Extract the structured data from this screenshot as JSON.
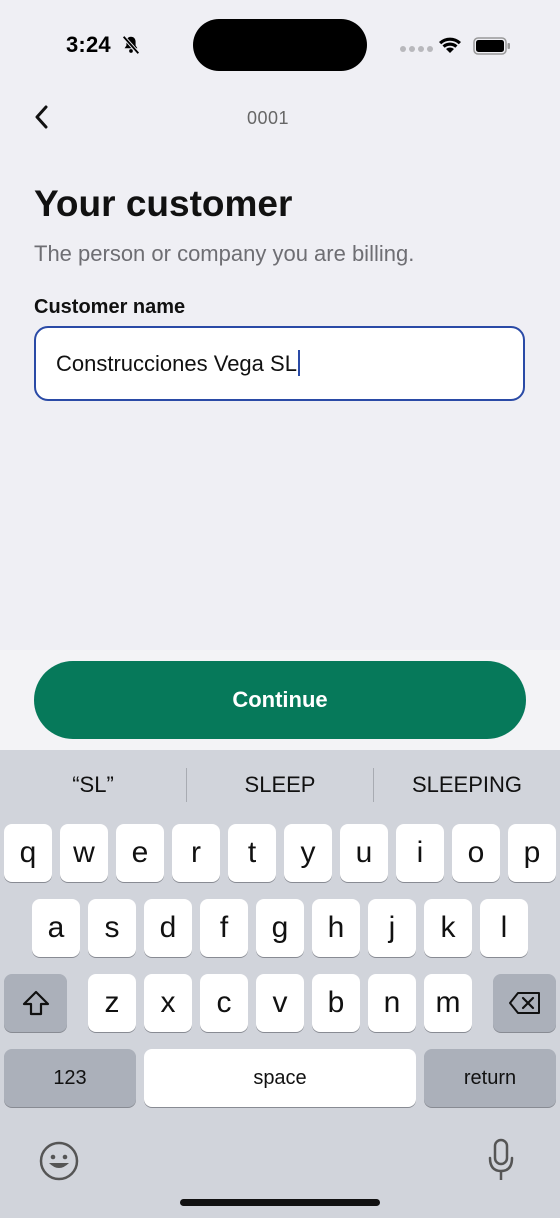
{
  "status_bar": {
    "time": "3:24"
  },
  "header": {
    "title": "0001"
  },
  "page": {
    "title": "Your customer",
    "subtitle": "The person or company you are billing."
  },
  "form": {
    "customer_name_label": "Customer name",
    "customer_name_value": "Construcciones Vega SL"
  },
  "actions": {
    "continue_label": "Continue"
  },
  "keyboard": {
    "suggestions": [
      "“SL”",
      "SLEEP",
      "SLEEPING"
    ],
    "row1": [
      "q",
      "w",
      "e",
      "r",
      "t",
      "y",
      "u",
      "i",
      "o",
      "p"
    ],
    "row2": [
      "a",
      "s",
      "d",
      "f",
      "g",
      "h",
      "j",
      "k",
      "l"
    ],
    "row3": [
      "z",
      "x",
      "c",
      "v",
      "b",
      "n",
      "m"
    ],
    "numbers_label": "123",
    "space_label": "space",
    "return_label": "return"
  },
  "colors": {
    "accent": "#06795A",
    "focus_border": "#2A4AA6",
    "background": "#EFEFF4"
  }
}
